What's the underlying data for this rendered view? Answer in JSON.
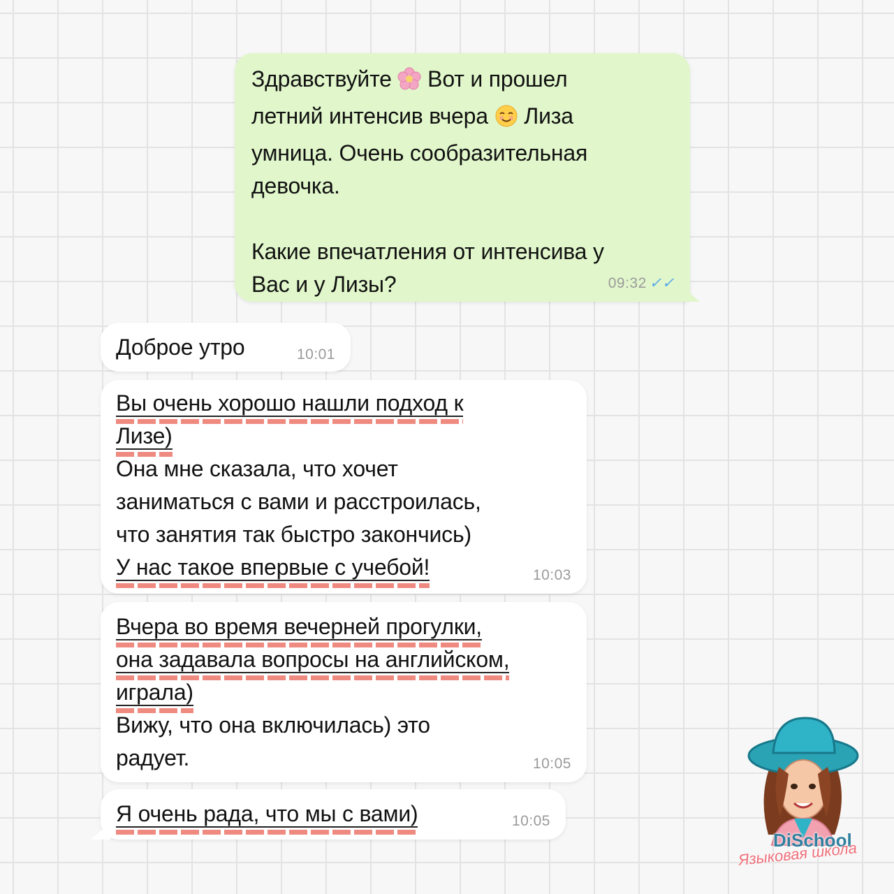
{
  "messages": [
    {
      "lines": [
        "Здравствуйте",
        "Вот и прошел",
        "летний интенсив вчера",
        "Лиза",
        "умница. Очень сообразительная",
        "девочка."
      ],
      "lines2": [
        "Какие впечатления от интенсива у",
        "Вас и у Лизы?"
      ],
      "time": "09:32",
      "ticks": "✓✓"
    },
    {
      "text": "Доброе утро",
      "time": "10:01"
    },
    {
      "lines": [
        "Вы очень хорошо нашли подход к",
        "Лизе)",
        "Она мне сказала, что хочет",
        "заниматься с вами и расстроилась,",
        "что занятия так быстро закончись)",
        "У нас такое впервые с учебой!"
      ],
      "time": "10:03"
    },
    {
      "lines": [
        "Вчера во время вечерней прогулки,",
        "она задавала вопросы на английском,",
        "играла)",
        "Вижу, что она включилась) это",
        "радует."
      ],
      "time": "10:05"
    },
    {
      "text": "Я очень рада, что мы с вами)",
      "time": "10:05"
    }
  ],
  "emojis": {
    "flower": "flower-emoji",
    "smile": "smiling-face-emoji"
  },
  "logo": {
    "title": "DiSchool",
    "subtitle": "Языковая школа"
  },
  "colors": {
    "outgoing_bubble": "#e1f7cb",
    "incoming_bubble": "#ffffff",
    "highlight": "#ef8a80",
    "read_ticks": "#56a6e8"
  }
}
